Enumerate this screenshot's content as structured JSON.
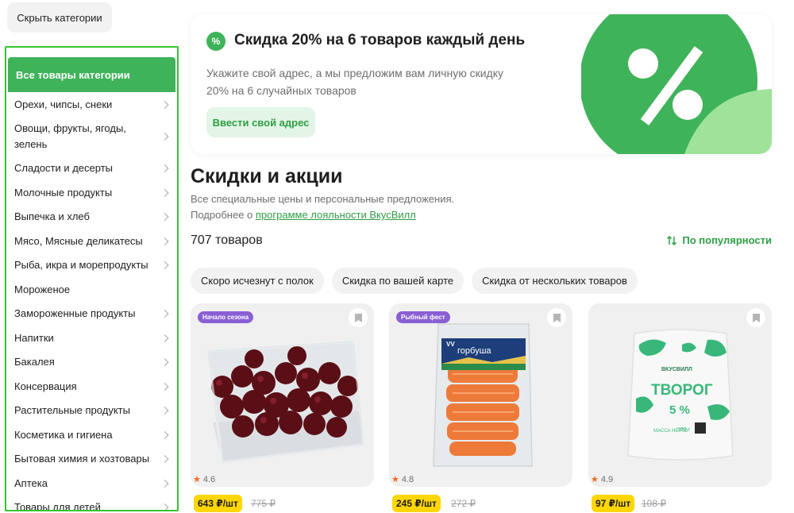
{
  "sidebar": {
    "hide_label": "Скрыть категории",
    "active_label": "Все товары категории",
    "items": [
      {
        "label": "Орехи, чипсы, снеки"
      },
      {
        "label": "Овощи, фрукты, ягоды, зелень"
      },
      {
        "label": "Сладости и десерты"
      },
      {
        "label": "Молочные продукты"
      },
      {
        "label": "Выпечка и хлеб"
      },
      {
        "label": "Мясо, Мясные деликатесы"
      },
      {
        "label": "Рыба, икра и морепродукты"
      },
      {
        "label": "Мороженое"
      },
      {
        "label": "Замороженные продукты"
      },
      {
        "label": "Напитки"
      },
      {
        "label": "Бакалея"
      },
      {
        "label": "Консервация"
      },
      {
        "label": "Растительные продукты"
      },
      {
        "label": "Косметика и гигиена"
      },
      {
        "label": "Бытовая химия и хозтовары"
      },
      {
        "label": "Аптека"
      },
      {
        "label": "Товары для детей"
      }
    ]
  },
  "banner": {
    "icon_glyph": "%",
    "title": "Скидка 20% на 6 товаров каждый день",
    "text": "Укажите свой адрес, а мы предложим вам личную скидку 20% на 6 случайных товаров",
    "button": "Ввести свой адрес",
    "accent": "#3fb35a"
  },
  "main": {
    "title": "Скидки и акции",
    "subtitle_line1": "Все специальные цены и персональные предложения.",
    "subtitle_prefix": "Подробнее о ",
    "loyalty_link": "программе лояльности ВкусВилл",
    "count": "707 товаров",
    "sort_label": "По популярности",
    "chips": [
      {
        "label": "Скоро исчезнут с полок"
      },
      {
        "label": "Скидка по вашей карте"
      },
      {
        "label": "Скидка от нескольких товаров"
      }
    ]
  },
  "products": [
    {
      "badge": "Начало сезона",
      "rating": "4.6",
      "price": "643 ₽/шт",
      "old_price": "775 ₽",
      "image": "cherries-in-plastic-box"
    },
    {
      "badge": "Рыбный фест",
      "rating": "4.8",
      "price": "245 ₽/шт",
      "old_price": "272 ₽",
      "image": "salmon-pack",
      "package_brand": "VV",
      "package_name": "горбуша"
    },
    {
      "badge": "",
      "rating": "4.9",
      "price": "97 ₽/шт",
      "old_price": "108 ₽",
      "image": "cottage-cheese-pack",
      "package_brand": "ВКУСВИЛЛ",
      "package_name": "ТВОРОГ",
      "package_fat": "5 %",
      "package_net": "МАССА НЕТТО",
      "package_weight": "180 г"
    }
  ],
  "colors": {
    "green": "#3fb35a",
    "link_green": "#2f9e45",
    "price_yellow": "#ffd600",
    "badge_purple": "#8a5fd4",
    "star_orange": "#f06a1d"
  }
}
